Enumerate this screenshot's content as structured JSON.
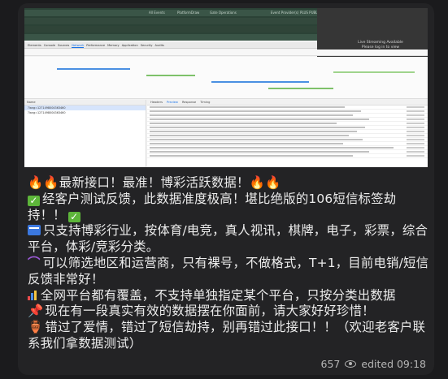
{
  "screenshot": {
    "app_bar_tags": [
      "All Events",
      "PlatformDraw",
      "Gate Operations",
      "Event Provider(s)",
      "PLUS PUBLIC"
    ],
    "video_caption_1": "Live Streaming Available",
    "video_caption_2": "Please log in to view",
    "devtools_tabs": [
      "Elements",
      "Console",
      "Sources",
      "Network",
      "Performance",
      "Memory",
      "Application",
      "Security",
      "Audits"
    ],
    "devtools_active_tab": "Network",
    "name_header": "Name",
    "name_items": [
      "?lang=1271498004363460",
      "?lang=1271498004363460"
    ],
    "detail_tabs": [
      "Headers",
      "Preview",
      "Response",
      "Timing"
    ],
    "detail_active_tab": "Preview",
    "colors": {
      "app_bar": "#2b4236",
      "selected_row": "#d6e4fb",
      "link": "#1a73e8"
    }
  },
  "message": {
    "line1": "最新接口！最准！博彩活跃数据！",
    "line2": "经客户测试反馈，此数据准度极高！堪比绝版的106短信标签劫持！！",
    "line3": "只支持博彩行业，按体育/电竞，真人视讯，棋牌，电子，彩票，综合平台，体彩/竞彩分类。",
    "line4": "可以筛选地区和运营商，只有裸号，不做格式，T+1，目前电销/短信反馈非常好！",
    "line5": "全网平台都有覆盖，不支持单独指定某个平台，只按分类出数据",
    "line6": "现在有一段真实有效的数据摆在你面前，请大家好好珍惜！",
    "line7": "错过了爱情，错过了短信劫持，别再错过此接口！！（欢迎老客户联系我们拿数据测试）",
    "icons": [
      "fire-icon",
      "check-mark-icon",
      "card-icon",
      "hook-icon",
      "chart-bars-icon",
      "pushpin-icon",
      "jar-icon"
    ]
  },
  "footer": {
    "views": "657",
    "edited": "edited 09:18"
  }
}
